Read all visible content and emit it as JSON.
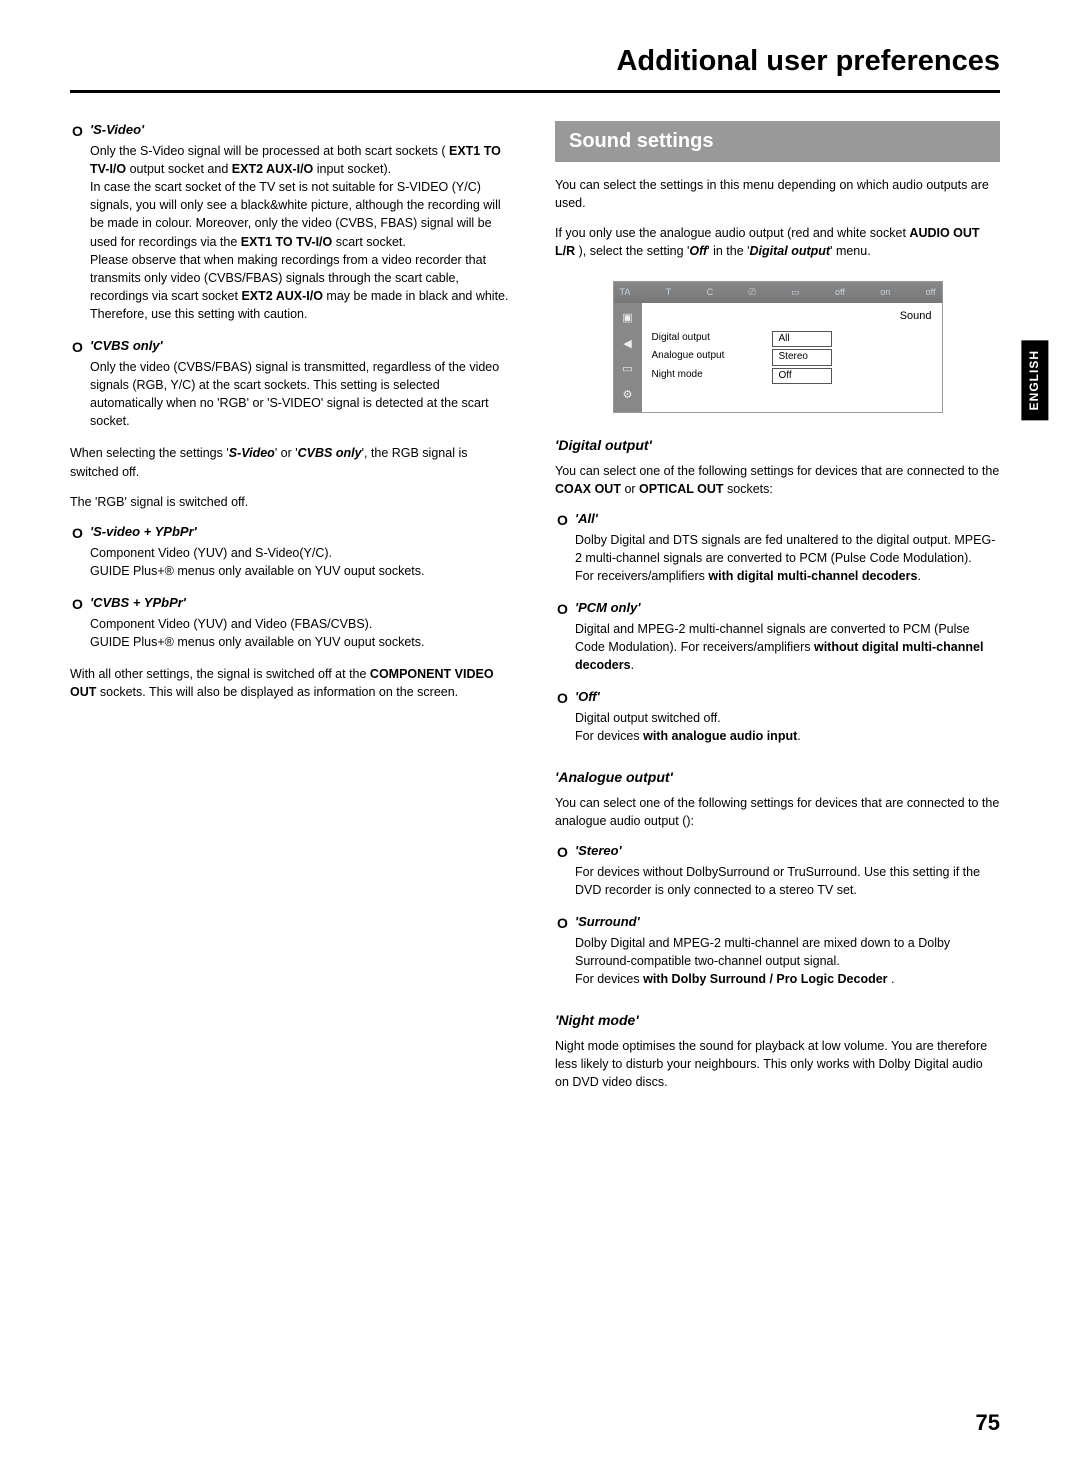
{
  "header": {
    "title": "Additional user preferences"
  },
  "language_tab": "ENGLISH",
  "page_number": "75",
  "left": {
    "svideo": {
      "title": "'S-Video'",
      "p1a": "Only the S-Video signal will be processed at both scart sockets ( ",
      "p1b": "EXT1 TO TV-I/O",
      "p1c": " output socket and ",
      "p1d": "EXT2 AUX-I/O",
      "p1e": " input socket).",
      "p2": "In case the scart socket of the TV set is not suitable for S-VIDEO (Y/C) signals, you will only see a black&white picture, although the recording will be made in colour. Moreover, only the video (CVBS, FBAS) signal will be used for recordings via the ",
      "p2b": "EXT1 TO TV-I/O",
      "p2c": " scart socket.",
      "p3a": "Please observe that when making recordings from a video recorder that transmits only video (CVBS/FBAS) signals through the scart cable, recordings via scart socket ",
      "p3b": "EXT2 AUX-I/O",
      "p3c": " may be made in black and white.",
      "p4": "Therefore, use this setting with caution."
    },
    "cvbsonly": {
      "title": "'CVBS only'",
      "body": "Only the video (CVBS/FBAS) signal is transmitted, regardless of the video signals (RGB, Y/C) at the scart sockets. This setting is selected automatically when no 'RGB' or 'S-VIDEO' signal is detected at the scart socket."
    },
    "note1a": "When selecting the settings '",
    "note1b": "S-Video",
    "note1c": "' or '",
    "note1d": "CVBS only",
    "note1e": "', the RGB signal is switched off.",
    "note2": "The 'RGB' signal is switched off.",
    "svypbpr": {
      "title": "'S-video + YPbPr'",
      "l1": "Component Video (YUV) and S-Video(Y/C).",
      "l2": "GUIDE Plus+® menus only available on YUV ouput sockets."
    },
    "cvbsypbpr": {
      "title": "'CVBS + YPbPr'",
      "l1": "Component Video (YUV) and Video (FBAS/CVBS).",
      "l2": "GUIDE Plus+® menus only available on YUV ouput sockets."
    },
    "note3a": "With all other settings, the signal is switched off at the ",
    "note3b": "COMPONENT VIDEO OUT",
    "note3c": " sockets. This will also be displayed as information on the screen."
  },
  "right": {
    "section": "Sound settings",
    "intro1": "You can select the settings in this menu depending on which audio outputs are used.",
    "intro2a": "If you only use the analogue audio output (red and white socket ",
    "intro2b": "AUDIO OUT L/R",
    "intro2c": " ), select the setting '",
    "intro2d": "Off",
    "intro2e": "' in the '",
    "intro2f": "Digital output",
    "intro2g": "' menu.",
    "osd": {
      "title": "Sound",
      "rows": [
        {
          "label": "Digital output",
          "value": "All"
        },
        {
          "label": "Analogue output",
          "value": "Stereo"
        },
        {
          "label": "Night mode",
          "value": "Off"
        }
      ],
      "top": [
        "TA",
        "T",
        "C",
        "",
        "",
        "off",
        "on",
        "off"
      ]
    },
    "digital": {
      "heading": "'Digital output'",
      "intro_a": "You can select one of the following settings for devices that are connected to the ",
      "intro_b": "COAX OUT",
      "intro_c": " or ",
      "intro_d": "OPTICAL OUT",
      "intro_e": " sockets:",
      "all": {
        "title": "'All'",
        "p1": "Dolby Digital and DTS signals are fed unaltered to the digital output. MPEG-2 multi-channel signals are converted to PCM (Pulse Code Modulation).",
        "p2a": "For receivers/amplifiers ",
        "p2b": "with digital multi-channel decoders",
        "p2c": "."
      },
      "pcm": {
        "title": "'PCM only'",
        "p1a": "Digital and MPEG-2 multi-channel signals are converted to PCM (Pulse Code Modulation). For receivers/amplifiers ",
        "p1b": "without digital multi-channel decoders",
        "p1c": "."
      },
      "off": {
        "title": "'Off'",
        "p1": "Digital output switched off.",
        "p2a": "For devices ",
        "p2b": "with analogue audio input",
        "p2c": "."
      }
    },
    "analogue": {
      "heading": "'Analogue output'",
      "intro": "You can select one of the following settings for devices that are connected to the analogue audio output ():",
      "stereo": {
        "title": "'Stereo'",
        "body": "For devices without DolbySurround or TruSurround. Use this setting if the DVD recorder is only connected to a stereo TV set."
      },
      "surround": {
        "title": "'Surround'",
        "p1": "Dolby Digital and MPEG-2 multi-channel are mixed down to a Dolby Surround-compatible two-channel output signal.",
        "p2a": "For devices ",
        "p2b": "with Dolby Surround / Pro Logic Decoder",
        "p2c": " ."
      }
    },
    "night": {
      "heading": "'Night mode'",
      "body": "Night mode optimises the sound for playback at low volume. You are therefore less likely to disturb your neighbours. This only works with Dolby Digital audio on DVD video discs."
    }
  }
}
